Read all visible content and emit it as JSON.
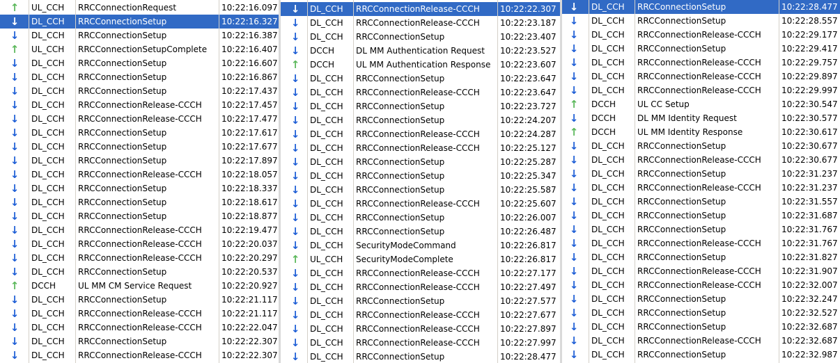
{
  "panels": [
    {
      "rows": [
        {
          "dir": "up",
          "channel": "UL_CCH",
          "message": "RRCConnectionRequest",
          "time": "10:22:16.097"
        },
        {
          "dir": "down",
          "channel": "DL_CCH",
          "message": "RRCConnectionSetup",
          "time": "10:22:16.327",
          "selected": true
        },
        {
          "dir": "down",
          "channel": "DL_CCH",
          "message": "RRCConnectionSetup",
          "time": "10:22:16.387"
        },
        {
          "dir": "up",
          "channel": "UL_CCH",
          "message": "RRCConnectionSetupComplete",
          "time": "10:22:16.407"
        },
        {
          "dir": "down",
          "channel": "DL_CCH",
          "message": "RRCConnectionSetup",
          "time": "10:22:16.607"
        },
        {
          "dir": "down",
          "channel": "DL_CCH",
          "message": "RRCConnectionSetup",
          "time": "10:22:16.867"
        },
        {
          "dir": "down",
          "channel": "DL_CCH",
          "message": "RRCConnectionSetup",
          "time": "10:22:17.437"
        },
        {
          "dir": "down",
          "channel": "DL_CCH",
          "message": "RRCConnectionRelease-CCCH",
          "time": "10:22:17.457"
        },
        {
          "dir": "down",
          "channel": "DL_CCH",
          "message": "RRCConnectionRelease-CCCH",
          "time": "10:22:17.477"
        },
        {
          "dir": "down",
          "channel": "DL_CCH",
          "message": "RRCConnectionSetup",
          "time": "10:22:17.617"
        },
        {
          "dir": "down",
          "channel": "DL_CCH",
          "message": "RRCConnectionSetup",
          "time": "10:22:17.677"
        },
        {
          "dir": "down",
          "channel": "DL_CCH",
          "message": "RRCConnectionSetup",
          "time": "10:22:17.897"
        },
        {
          "dir": "down",
          "channel": "DL_CCH",
          "message": "RRCConnectionRelease-CCCH",
          "time": "10:22:18.057"
        },
        {
          "dir": "down",
          "channel": "DL_CCH",
          "message": "RRCConnectionSetup",
          "time": "10:22:18.337"
        },
        {
          "dir": "down",
          "channel": "DL_CCH",
          "message": "RRCConnectionSetup",
          "time": "10:22:18.617"
        },
        {
          "dir": "down",
          "channel": "DL_CCH",
          "message": "RRCConnectionSetup",
          "time": "10:22:18.877"
        },
        {
          "dir": "down",
          "channel": "DL_CCH",
          "message": "RRCConnectionRelease-CCCH",
          "time": "10:22:19.477"
        },
        {
          "dir": "down",
          "channel": "DL_CCH",
          "message": "RRCConnectionRelease-CCCH",
          "time": "10:22:20.037"
        },
        {
          "dir": "down",
          "channel": "DL_CCH",
          "message": "RRCConnectionRelease-CCCH",
          "time": "10:22:20.297"
        },
        {
          "dir": "down",
          "channel": "DL_CCH",
          "message": "RRCConnectionSetup",
          "time": "10:22:20.537"
        },
        {
          "dir": "up",
          "channel": "DCCH",
          "message": "UL MM CM Service Request",
          "time": "10:22:20.927"
        },
        {
          "dir": "down",
          "channel": "DL_CCH",
          "message": "RRCConnectionSetup",
          "time": "10:22:21.117"
        },
        {
          "dir": "down",
          "channel": "DL_CCH",
          "message": "RRCConnectionRelease-CCCH",
          "time": "10:22:21.117"
        },
        {
          "dir": "down",
          "channel": "DL_CCH",
          "message": "RRCConnectionRelease-CCCH",
          "time": "10:22:22.047"
        },
        {
          "dir": "down",
          "channel": "DL_CCH",
          "message": "RRCConnectionSetup",
          "time": "10:22:22.307"
        },
        {
          "dir": "down",
          "channel": "DL_CCH",
          "message": "RRCConnectionRelease-CCCH",
          "time": "10:22:22.307"
        }
      ]
    },
    {
      "rows": [
        {
          "dir": "down",
          "channel": "DL_CCH",
          "message": "RRCConnectionRelease-CCCH",
          "time": "10:22:22.307",
          "selected": true
        },
        {
          "dir": "down",
          "channel": "DL_CCH",
          "message": "RRCConnectionRelease-CCCH",
          "time": "10:22:23.187"
        },
        {
          "dir": "down",
          "channel": "DL_CCH",
          "message": "RRCConnectionSetup",
          "time": "10:22:23.407"
        },
        {
          "dir": "down",
          "channel": "DCCH",
          "message": "DL MM Authentication Request",
          "time": "10:22:23.527"
        },
        {
          "dir": "up",
          "channel": "DCCH",
          "message": "UL MM Authentication Response",
          "time": "10:22:23.607"
        },
        {
          "dir": "down",
          "channel": "DL_CCH",
          "message": "RRCConnectionSetup",
          "time": "10:22:23.647"
        },
        {
          "dir": "down",
          "channel": "DL_CCH",
          "message": "RRCConnectionRelease-CCCH",
          "time": "10:22:23.647"
        },
        {
          "dir": "down",
          "channel": "DL_CCH",
          "message": "RRCConnectionSetup",
          "time": "10:22:23.727"
        },
        {
          "dir": "down",
          "channel": "DL_CCH",
          "message": "RRCConnectionSetup",
          "time": "10:22:24.207"
        },
        {
          "dir": "down",
          "channel": "DL_CCH",
          "message": "RRCConnectionRelease-CCCH",
          "time": "10:22:24.287"
        },
        {
          "dir": "down",
          "channel": "DL_CCH",
          "message": "RRCConnectionRelease-CCCH",
          "time": "10:22:25.127"
        },
        {
          "dir": "down",
          "channel": "DL_CCH",
          "message": "RRCConnectionSetup",
          "time": "10:22:25.287"
        },
        {
          "dir": "down",
          "channel": "DL_CCH",
          "message": "RRCConnectionSetup",
          "time": "10:22:25.347"
        },
        {
          "dir": "down",
          "channel": "DL_CCH",
          "message": "RRCConnectionSetup",
          "time": "10:22:25.587"
        },
        {
          "dir": "down",
          "channel": "DL_CCH",
          "message": "RRCConnectionRelease-CCCH",
          "time": "10:22:25.607"
        },
        {
          "dir": "down",
          "channel": "DL_CCH",
          "message": "RRCConnectionSetup",
          "time": "10:22:26.007"
        },
        {
          "dir": "down",
          "channel": "DL_CCH",
          "message": "RRCConnectionSetup",
          "time": "10:22:26.487"
        },
        {
          "dir": "down",
          "channel": "DL_CCH",
          "message": "SecurityModeCommand",
          "time": "10:22:26.817"
        },
        {
          "dir": "up",
          "channel": "UL_CCH",
          "message": "SecurityModeComplete",
          "time": "10:22:26.817"
        },
        {
          "dir": "down",
          "channel": "DL_CCH",
          "message": "RRCConnectionRelease-CCCH",
          "time": "10:22:27.177"
        },
        {
          "dir": "down",
          "channel": "DL_CCH",
          "message": "RRCConnectionRelease-CCCH",
          "time": "10:22:27.497"
        },
        {
          "dir": "down",
          "channel": "DL_CCH",
          "message": "RRCConnectionSetup",
          "time": "10:22:27.577"
        },
        {
          "dir": "down",
          "channel": "DL_CCH",
          "message": "RRCConnectionRelease-CCCH",
          "time": "10:22:27.677"
        },
        {
          "dir": "down",
          "channel": "DL_CCH",
          "message": "RRCConnectionRelease-CCCH",
          "time": "10:22:27.897"
        },
        {
          "dir": "down",
          "channel": "DL_CCH",
          "message": "RRCConnectionRelease-CCCH",
          "time": "10:22:27.997"
        },
        {
          "dir": "down",
          "channel": "DL_CCH",
          "message": "RRCConnectionSetup",
          "time": "10:22:28.477"
        }
      ]
    },
    {
      "rows": [
        {
          "dir": "down",
          "channel": "DL_CCH",
          "message": "RRCConnectionSetup",
          "time": "10:22:28.477",
          "selected": true
        },
        {
          "dir": "down",
          "channel": "DL_CCH",
          "message": "RRCConnectionSetup",
          "time": "10:22:28.557"
        },
        {
          "dir": "down",
          "channel": "DL_CCH",
          "message": "RRCConnectionRelease-CCCH",
          "time": "10:22:29.177"
        },
        {
          "dir": "down",
          "channel": "DL_CCH",
          "message": "RRCConnectionSetup",
          "time": "10:22:29.417"
        },
        {
          "dir": "down",
          "channel": "DL_CCH",
          "message": "RRCConnectionRelease-CCCH",
          "time": "10:22:29.757"
        },
        {
          "dir": "down",
          "channel": "DL_CCH",
          "message": "RRCConnectionRelease-CCCH",
          "time": "10:22:29.897"
        },
        {
          "dir": "down",
          "channel": "DL_CCH",
          "message": "RRCConnectionRelease-CCCH",
          "time": "10:22:29.997"
        },
        {
          "dir": "up",
          "channel": "DCCH",
          "message": "UL CC Setup",
          "time": "10:22:30.547"
        },
        {
          "dir": "down",
          "channel": "DCCH",
          "message": "DL MM Identity Request",
          "time": "10:22:30.577"
        },
        {
          "dir": "up",
          "channel": "DCCH",
          "message": "UL MM Identity Response",
          "time": "10:22:30.617"
        },
        {
          "dir": "down",
          "channel": "DL_CCH",
          "message": "RRCConnectionSetup",
          "time": "10:22:30.677"
        },
        {
          "dir": "down",
          "channel": "DL_CCH",
          "message": "RRCConnectionRelease-CCCH",
          "time": "10:22:30.677"
        },
        {
          "dir": "down",
          "channel": "DL_CCH",
          "message": "RRCConnectionSetup",
          "time": "10:22:31.237"
        },
        {
          "dir": "down",
          "channel": "DL_CCH",
          "message": "RRCConnectionRelease-CCCH",
          "time": "10:22:31.237"
        },
        {
          "dir": "down",
          "channel": "DL_CCH",
          "message": "RRCConnectionSetup",
          "time": "10:22:31.557"
        },
        {
          "dir": "down",
          "channel": "DL_CCH",
          "message": "RRCConnectionSetup",
          "time": "10:22:31.687"
        },
        {
          "dir": "down",
          "channel": "DL_CCH",
          "message": "RRCConnectionSetup",
          "time": "10:22:31.767"
        },
        {
          "dir": "down",
          "channel": "DL_CCH",
          "message": "RRCConnectionRelease-CCCH",
          "time": "10:22:31.767"
        },
        {
          "dir": "down",
          "channel": "DL_CCH",
          "message": "RRCConnectionSetup",
          "time": "10:22:31.827"
        },
        {
          "dir": "down",
          "channel": "DL_CCH",
          "message": "RRCConnectionRelease-CCCH",
          "time": "10:22:31.907"
        },
        {
          "dir": "down",
          "channel": "DL_CCH",
          "message": "RRCConnectionRelease-CCCH",
          "time": "10:22:32.007"
        },
        {
          "dir": "down",
          "channel": "DL_CCH",
          "message": "RRCConnectionSetup",
          "time": "10:22:32.247"
        },
        {
          "dir": "down",
          "channel": "DL_CCH",
          "message": "RRCConnectionSetup",
          "time": "10:22:32.527"
        },
        {
          "dir": "down",
          "channel": "DL_CCH",
          "message": "RRCConnectionSetup",
          "time": "10:22:32.687"
        },
        {
          "dir": "down",
          "channel": "DL_CCH",
          "message": "RRCConnectionRelease-CCCH",
          "time": "10:22:32.687"
        },
        {
          "dir": "down",
          "channel": "DL_CCH",
          "message": "RRCConnectionSetup",
          "time": "10:22:32.987"
        }
      ]
    }
  ],
  "icons": {
    "down": "arrow-down-icon",
    "up": "arrow-up-icon"
  },
  "colors": {
    "selection": "#316ac5",
    "down_arrow": "#1f5fd6",
    "up_arrow": "#5cb85c"
  }
}
